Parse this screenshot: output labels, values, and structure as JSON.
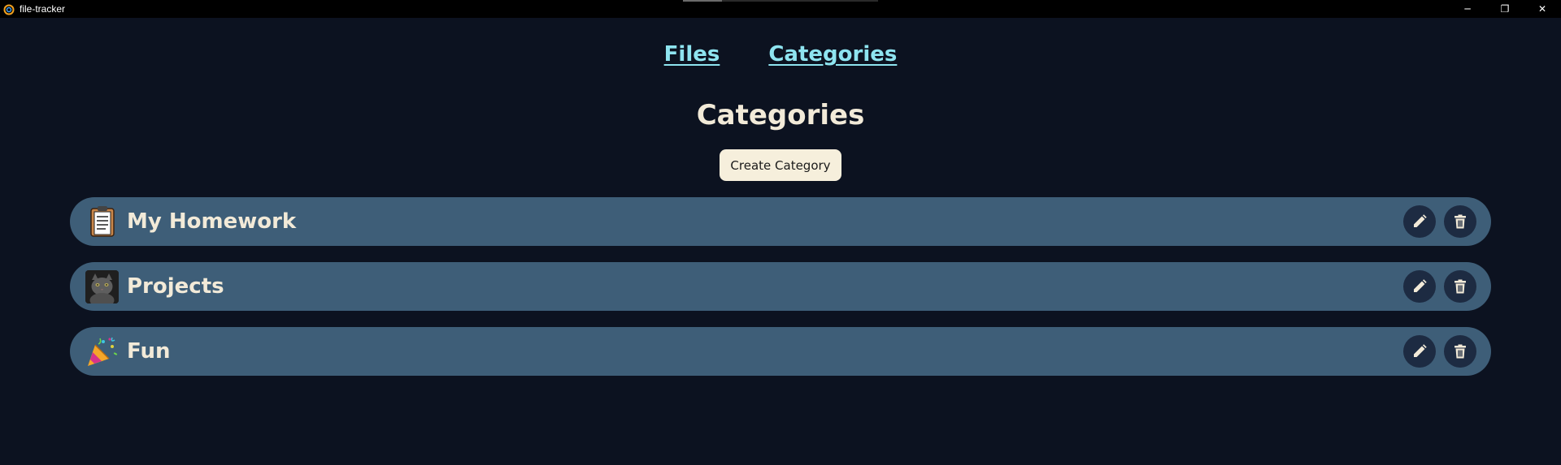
{
  "window": {
    "title": "file-tracker",
    "controls": {
      "minimize": "─",
      "restore": "❐",
      "close": "✕"
    }
  },
  "nav": {
    "files_label": "Files",
    "categories_label": "Categories"
  },
  "page": {
    "heading": "Categories",
    "create_button_label": "Create Category"
  },
  "categories": [
    {
      "name": "My Homework",
      "thumbnail": "clipboard-icon"
    },
    {
      "name": "Projects",
      "thumbnail": "cat-photo"
    },
    {
      "name": "Fun",
      "thumbnail": "party-popper-icon"
    }
  ],
  "colors": {
    "background": "#0c1220",
    "row": "#3e5e78",
    "link": "#8ee4f0",
    "text": "#f2ead8",
    "button": "#f6efdc",
    "icon_button": "#1d2b42"
  }
}
